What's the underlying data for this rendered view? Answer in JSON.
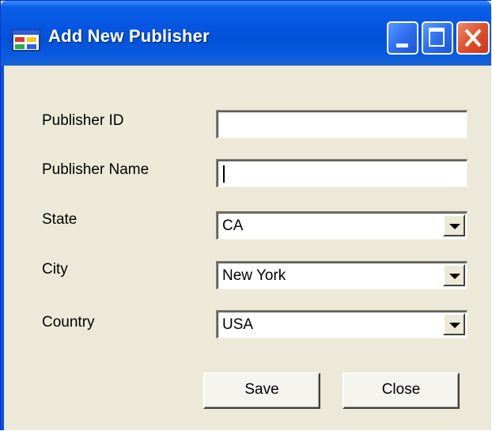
{
  "window": {
    "title": "Add New Publisher"
  },
  "title_buttons": {
    "minimize": "minimize",
    "maximize": "maximize",
    "close": "close"
  },
  "form": {
    "publisher_id": {
      "label": "Publisher ID",
      "value": ""
    },
    "publisher_name": {
      "label": "Publisher Name",
      "value": ""
    },
    "state": {
      "label": "State",
      "value": "CA"
    },
    "city": {
      "label": "City",
      "value": "New York"
    },
    "country": {
      "label": "Country",
      "value": "USA"
    }
  },
  "buttons": {
    "save": "Save",
    "close": "Close"
  },
  "colors": {
    "titlebar": "#0654e0",
    "window_bg": "#ece9d8",
    "close_button": "#e0502c"
  },
  "icons": {
    "app": "form-icon",
    "dropdown": "chevron-down-icon"
  }
}
